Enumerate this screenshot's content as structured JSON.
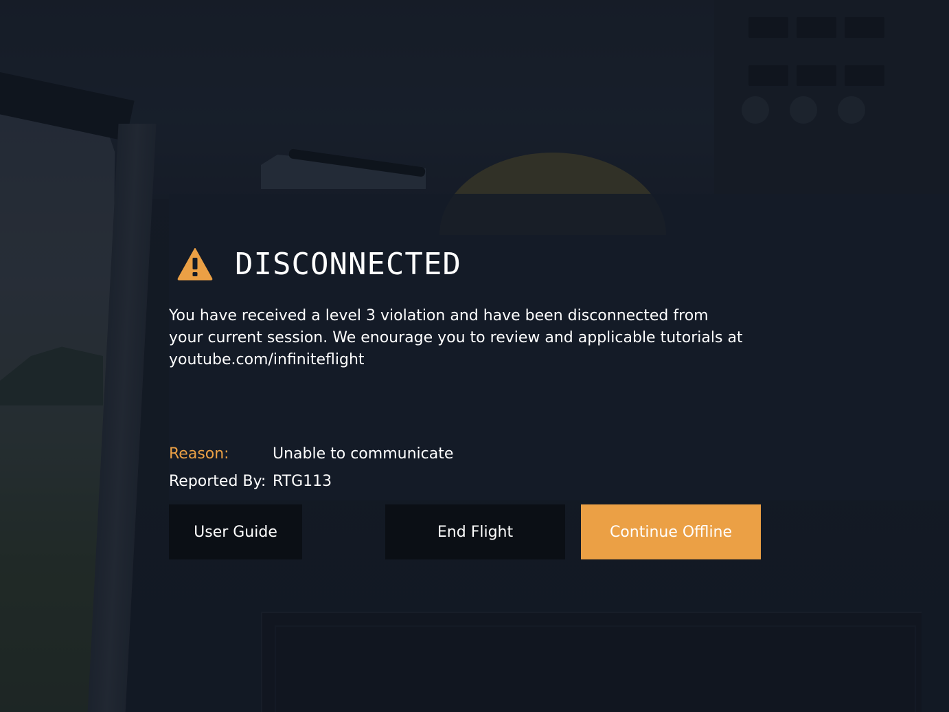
{
  "dialog": {
    "title": "DISCONNECTED",
    "icon": "warning-icon",
    "message": "You have received a level 3 violation and have been disconnected from your current session. We enourage you to review and applicable tutorials at youtube.com/infiniteflight",
    "reason_label": "Reason:",
    "reason_value": "Unable to communicate",
    "reported_by_label": "Reported By:",
    "reported_by_value": "RTG113"
  },
  "buttons": {
    "user_guide": "User Guide",
    "end_flight": "End Flight",
    "continue_offline": "Continue Offline"
  },
  "colors": {
    "accent": "#eba045",
    "reason_label": "#eba045",
    "text": "#ffffff",
    "button_bg": "#0b0f15"
  }
}
